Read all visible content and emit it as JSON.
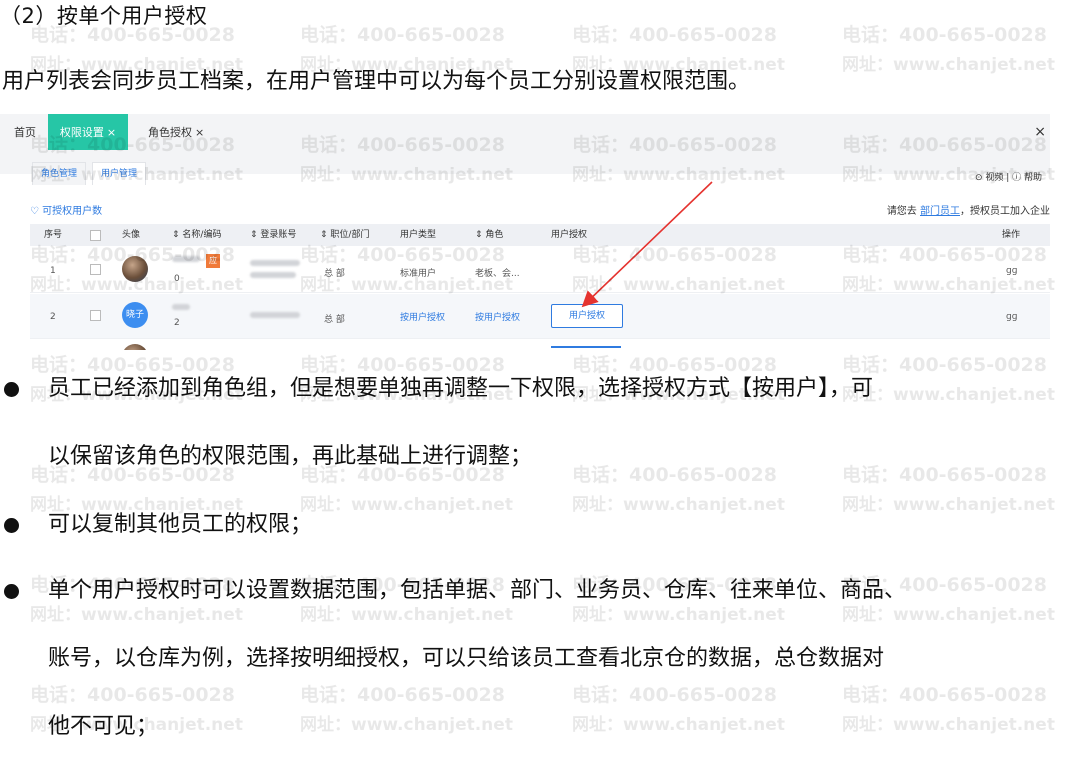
{
  "heading": "（2）按单个用户授权",
  "intro": "用户列表会同步员工档案，在用户管理中可以为每个员工分别设置权限范围。",
  "watermark": {
    "phone": "电话：400-665-0028",
    "url": "网址：www.chanjet.net"
  },
  "screenshot": {
    "tabs": {
      "home": "首页",
      "perm": "权限设置",
      "role": "角色授权",
      "close": "×"
    },
    "subtabs": {
      "role_mgmt": "角色管理",
      "user_mgmt": "用户管理"
    },
    "help": "⊙ 视频 | ⓘ 帮助",
    "auth_count": "♡ 可授权用户数",
    "hint_prefix": "请您去",
    "hint_link": "部门员工",
    "hint_suffix": "，授权员工加入企业",
    "columns": {
      "seq": "序号",
      "avatar": "头像",
      "name": "名称/编码",
      "account": "登录账号",
      "dept": "职位/部门",
      "utype": "用户类型",
      "role": "角色",
      "auth": "用户授权",
      "ops": "操作"
    },
    "rows": [
      {
        "seq": "1",
        "code": "0",
        "badge": "应",
        "dept": "总 部",
        "utype": "标准用户",
        "role": "老板、会..."
      },
      {
        "seq": "2",
        "avatar_text": "晓子",
        "code": "2",
        "dept": "总 部",
        "utype": "按用户授权",
        "role": "按用户授权",
        "auth_button": "用户授权"
      }
    ],
    "ops_icon": "ɡɡ"
  },
  "bullets": [
    [
      "员工已经添加到角色组，但是想要单独再调整一下权限，选择授权方式【按用户】，可",
      "以保留该角色的权限范围，再此基础上进行调整；"
    ],
    [
      "可以复制其他员工的权限；"
    ],
    [
      "单个用户授权时可以设置数据范围，包括单据、部门、业务员、仓库、往来单位、商品、",
      "账号，以仓库为例，选择按明细授权，可以只给该员工查看北京仓的数据，总仓数据对",
      "他不可见；"
    ]
  ]
}
